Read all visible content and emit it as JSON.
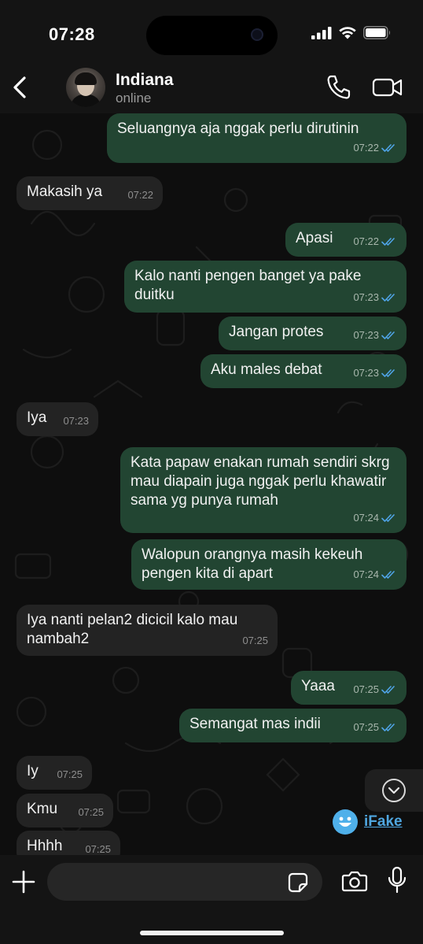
{
  "status_bar": {
    "time": "07:28"
  },
  "header": {
    "contact_name": "Indiana",
    "contact_status": "online"
  },
  "messages": [
    {
      "dir": "out",
      "text": "Seluangnya aja nggak perlu dirutinin",
      "time": "07:22",
      "ticks": "read"
    },
    {
      "dir": "in",
      "text": "Makasih ya",
      "time": "07:22"
    },
    {
      "dir": "out",
      "text": "Apasi",
      "time": "07:22",
      "ticks": "read"
    },
    {
      "dir": "out",
      "text": "Kalo nanti pengen banget ya pake duitku",
      "time": "07:23",
      "ticks": "read"
    },
    {
      "dir": "out",
      "text": "Jangan protes",
      "time": "07:23",
      "ticks": "read"
    },
    {
      "dir": "out",
      "text": "Aku males debat",
      "time": "07:23",
      "ticks": "read"
    },
    {
      "dir": "in",
      "text": "Iya",
      "time": "07:23"
    },
    {
      "dir": "out",
      "text": "Kata papaw enakan rumah sendiri skrg mau diapain juga nggak perlu khawatir sama yg punya rumah",
      "time": "07:24",
      "ticks": "read"
    },
    {
      "dir": "out",
      "text": "Walopun orangnya masih kekeuh pengen kita di apart",
      "time": "07:24",
      "ticks": "read"
    },
    {
      "dir": "in",
      "text": "Iya nanti pelan2 dicicil kalo mau nambah2",
      "time": "07:25"
    },
    {
      "dir": "out",
      "text": "Yaaa",
      "time": "07:25",
      "ticks": "read"
    },
    {
      "dir": "out",
      "text": "Semangat mas indii",
      "time": "07:25",
      "ticks": "read"
    },
    {
      "dir": "in",
      "text": "Iy",
      "time": "07:25"
    },
    {
      "dir": "in",
      "text": "Kmu",
      "time": "07:25"
    },
    {
      "dir": "in",
      "text": "Hhhh",
      "time": "07:25"
    }
  ],
  "watermark": {
    "label": "iFake"
  },
  "composer": {
    "placeholder": ""
  },
  "colors": {
    "outgoing_bubble": "#224532",
    "incoming_bubble": "#232323",
    "read_tick": "#4fa3e6",
    "background": "#0e0e0e"
  },
  "icons": {
    "back": "chevron-left-icon",
    "call": "phone-icon",
    "video": "video-camera-icon",
    "scroll": "chevron-down-icon",
    "plus": "plus-icon",
    "sticker": "sticker-icon",
    "camera": "camera-icon",
    "mic": "microphone-icon"
  }
}
